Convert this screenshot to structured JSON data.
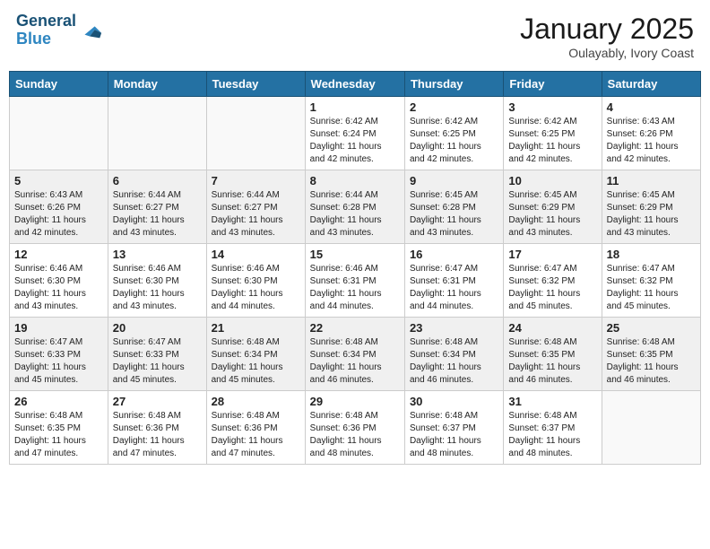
{
  "header": {
    "logo_line1": "General",
    "logo_line2": "Blue",
    "month": "January 2025",
    "location": "Oulayably, Ivory Coast"
  },
  "weekdays": [
    "Sunday",
    "Monday",
    "Tuesday",
    "Wednesday",
    "Thursday",
    "Friday",
    "Saturday"
  ],
  "weeks": [
    [
      {
        "day": "",
        "info": ""
      },
      {
        "day": "",
        "info": ""
      },
      {
        "day": "",
        "info": ""
      },
      {
        "day": "1",
        "info": "Sunrise: 6:42 AM\nSunset: 6:24 PM\nDaylight: 11 hours\nand 42 minutes."
      },
      {
        "day": "2",
        "info": "Sunrise: 6:42 AM\nSunset: 6:25 PM\nDaylight: 11 hours\nand 42 minutes."
      },
      {
        "day": "3",
        "info": "Sunrise: 6:42 AM\nSunset: 6:25 PM\nDaylight: 11 hours\nand 42 minutes."
      },
      {
        "day": "4",
        "info": "Sunrise: 6:43 AM\nSunset: 6:26 PM\nDaylight: 11 hours\nand 42 minutes."
      }
    ],
    [
      {
        "day": "5",
        "info": "Sunrise: 6:43 AM\nSunset: 6:26 PM\nDaylight: 11 hours\nand 42 minutes."
      },
      {
        "day": "6",
        "info": "Sunrise: 6:44 AM\nSunset: 6:27 PM\nDaylight: 11 hours\nand 43 minutes."
      },
      {
        "day": "7",
        "info": "Sunrise: 6:44 AM\nSunset: 6:27 PM\nDaylight: 11 hours\nand 43 minutes."
      },
      {
        "day": "8",
        "info": "Sunrise: 6:44 AM\nSunset: 6:28 PM\nDaylight: 11 hours\nand 43 minutes."
      },
      {
        "day": "9",
        "info": "Sunrise: 6:45 AM\nSunset: 6:28 PM\nDaylight: 11 hours\nand 43 minutes."
      },
      {
        "day": "10",
        "info": "Sunrise: 6:45 AM\nSunset: 6:29 PM\nDaylight: 11 hours\nand 43 minutes."
      },
      {
        "day": "11",
        "info": "Sunrise: 6:45 AM\nSunset: 6:29 PM\nDaylight: 11 hours\nand 43 minutes."
      }
    ],
    [
      {
        "day": "12",
        "info": "Sunrise: 6:46 AM\nSunset: 6:30 PM\nDaylight: 11 hours\nand 43 minutes."
      },
      {
        "day": "13",
        "info": "Sunrise: 6:46 AM\nSunset: 6:30 PM\nDaylight: 11 hours\nand 43 minutes."
      },
      {
        "day": "14",
        "info": "Sunrise: 6:46 AM\nSunset: 6:30 PM\nDaylight: 11 hours\nand 44 minutes."
      },
      {
        "day": "15",
        "info": "Sunrise: 6:46 AM\nSunset: 6:31 PM\nDaylight: 11 hours\nand 44 minutes."
      },
      {
        "day": "16",
        "info": "Sunrise: 6:47 AM\nSunset: 6:31 PM\nDaylight: 11 hours\nand 44 minutes."
      },
      {
        "day": "17",
        "info": "Sunrise: 6:47 AM\nSunset: 6:32 PM\nDaylight: 11 hours\nand 45 minutes."
      },
      {
        "day": "18",
        "info": "Sunrise: 6:47 AM\nSunset: 6:32 PM\nDaylight: 11 hours\nand 45 minutes."
      }
    ],
    [
      {
        "day": "19",
        "info": "Sunrise: 6:47 AM\nSunset: 6:33 PM\nDaylight: 11 hours\nand 45 minutes."
      },
      {
        "day": "20",
        "info": "Sunrise: 6:47 AM\nSunset: 6:33 PM\nDaylight: 11 hours\nand 45 minutes."
      },
      {
        "day": "21",
        "info": "Sunrise: 6:48 AM\nSunset: 6:34 PM\nDaylight: 11 hours\nand 45 minutes."
      },
      {
        "day": "22",
        "info": "Sunrise: 6:48 AM\nSunset: 6:34 PM\nDaylight: 11 hours\nand 46 minutes."
      },
      {
        "day": "23",
        "info": "Sunrise: 6:48 AM\nSunset: 6:34 PM\nDaylight: 11 hours\nand 46 minutes."
      },
      {
        "day": "24",
        "info": "Sunrise: 6:48 AM\nSunset: 6:35 PM\nDaylight: 11 hours\nand 46 minutes."
      },
      {
        "day": "25",
        "info": "Sunrise: 6:48 AM\nSunset: 6:35 PM\nDaylight: 11 hours\nand 46 minutes."
      }
    ],
    [
      {
        "day": "26",
        "info": "Sunrise: 6:48 AM\nSunset: 6:35 PM\nDaylight: 11 hours\nand 47 minutes."
      },
      {
        "day": "27",
        "info": "Sunrise: 6:48 AM\nSunset: 6:36 PM\nDaylight: 11 hours\nand 47 minutes."
      },
      {
        "day": "28",
        "info": "Sunrise: 6:48 AM\nSunset: 6:36 PM\nDaylight: 11 hours\nand 47 minutes."
      },
      {
        "day": "29",
        "info": "Sunrise: 6:48 AM\nSunset: 6:36 PM\nDaylight: 11 hours\nand 48 minutes."
      },
      {
        "day": "30",
        "info": "Sunrise: 6:48 AM\nSunset: 6:37 PM\nDaylight: 11 hours\nand 48 minutes."
      },
      {
        "day": "31",
        "info": "Sunrise: 6:48 AM\nSunset: 6:37 PM\nDaylight: 11 hours\nand 48 minutes."
      },
      {
        "day": "",
        "info": ""
      }
    ]
  ]
}
